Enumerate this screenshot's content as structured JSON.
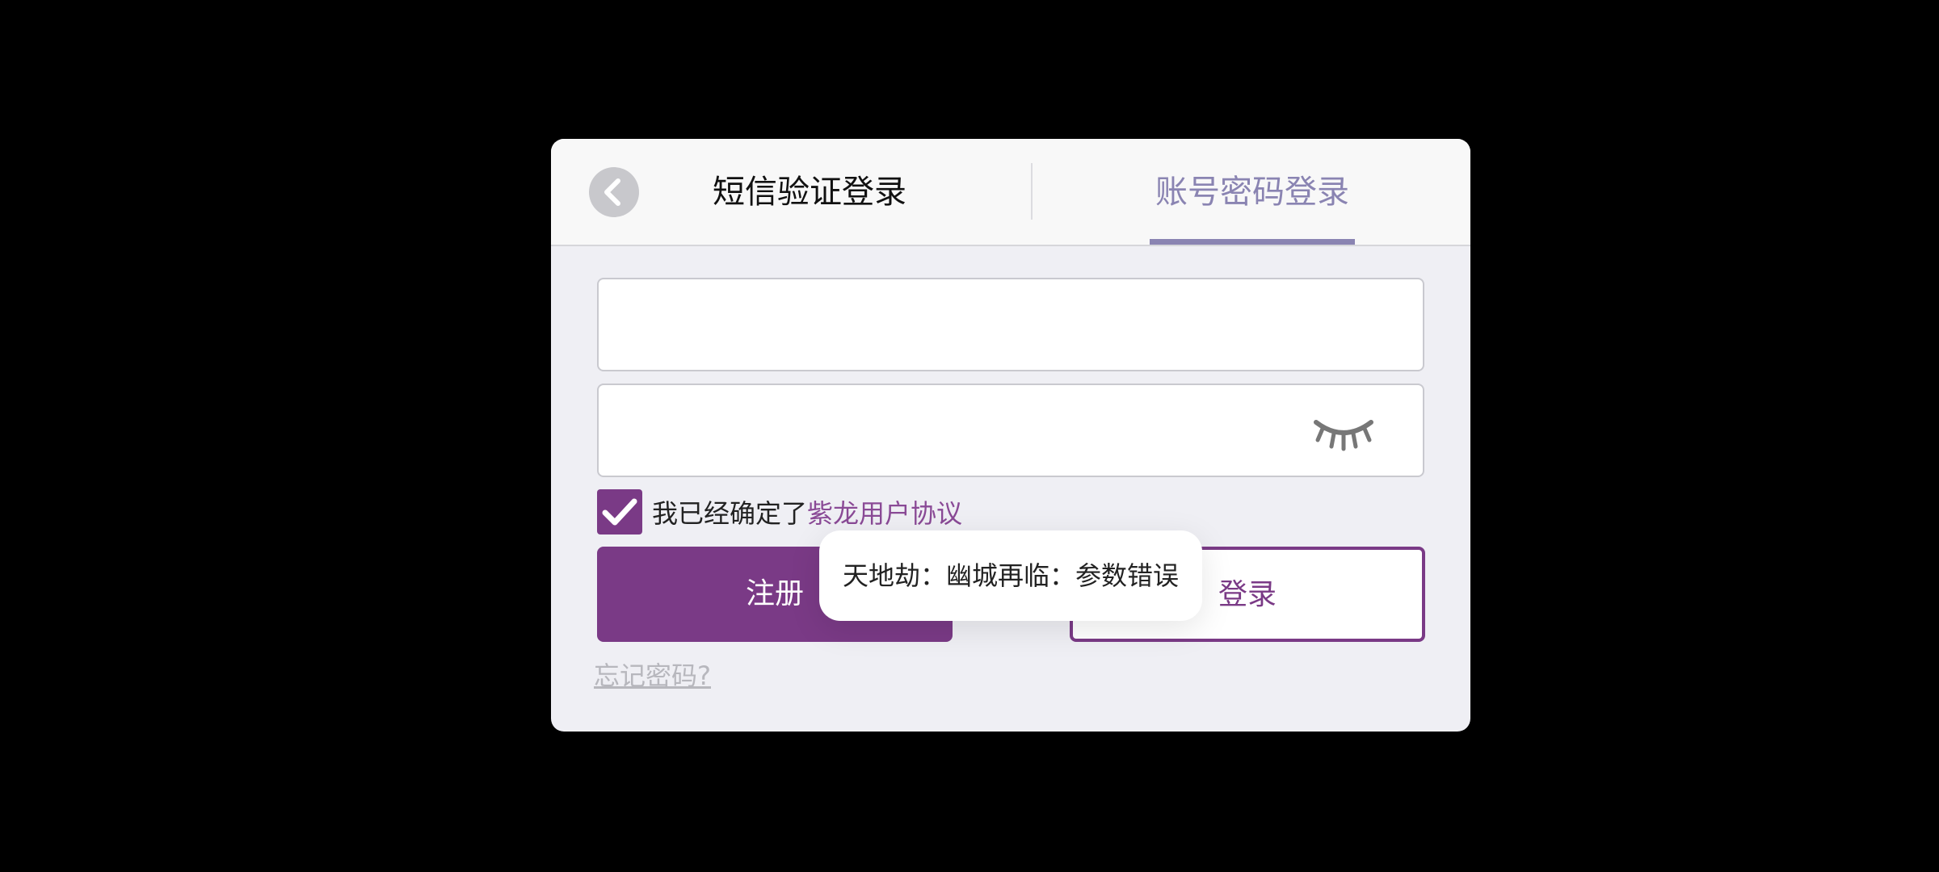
{
  "header": {
    "tab_sms": "短信验证登录",
    "tab_account": "账号密码登录",
    "active_tab": "账号密码登录",
    "back_icon": "chevron-left-icon"
  },
  "form": {
    "phone_value": "",
    "password_value": "",
    "password_visibility_icon": "eye-closed-icon"
  },
  "agreement": {
    "checked": true,
    "text": "我已经确定了",
    "link": "紫龙用户协议"
  },
  "buttons": {
    "register": "注册",
    "login": "登录"
  },
  "forgot": "忘记密码?",
  "toast": "天地劫：幽城再临：参数错误",
  "colors": {
    "accent": "#7a3a86",
    "tab_active": "#8a84b2",
    "background": "#efeff4"
  }
}
